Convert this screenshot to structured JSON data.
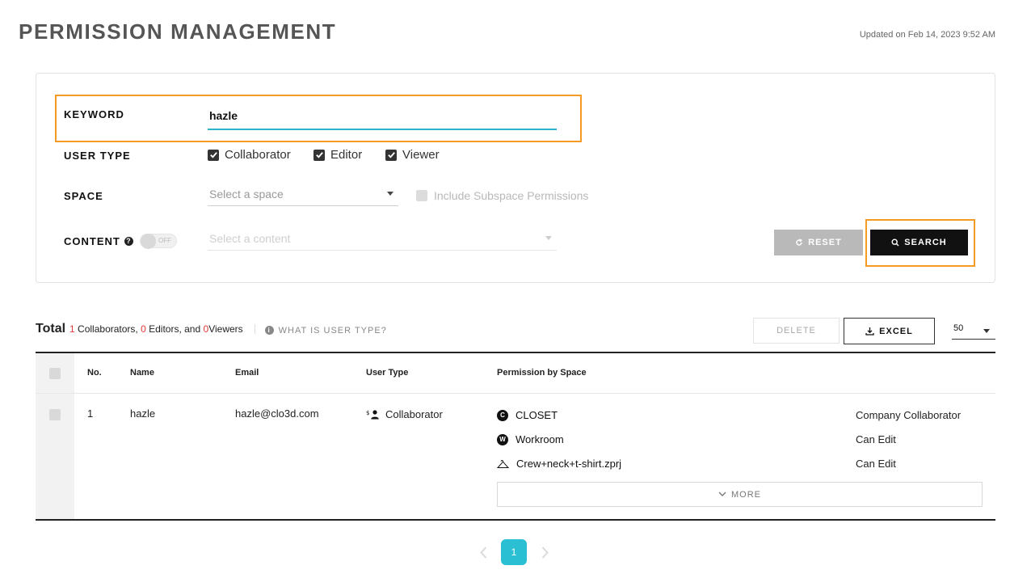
{
  "header": {
    "title": "PERMISSION MANAGEMENT",
    "updated": "Updated on Feb 14, 2023 9:52 AM"
  },
  "filters": {
    "keyword_label": "KEYWORD",
    "keyword_value": "hazle",
    "user_type_label": "USER TYPE",
    "user_types": [
      {
        "label": "Collaborator",
        "checked": true
      },
      {
        "label": "Editor",
        "checked": true
      },
      {
        "label": "Viewer",
        "checked": true
      }
    ],
    "space_label": "SPACE",
    "space_placeholder": "Select a space",
    "subspace_label": "Include Subspace Permissions",
    "content_label": "CONTENT",
    "content_toggle": "OFF",
    "content_placeholder": "Select a content",
    "reset_label": "RESET",
    "search_label": "SEARCH"
  },
  "summary": {
    "total_label": "Total",
    "collaborators_count": "1",
    "collaborators_text": " Collaborators, ",
    "editors_count": "0",
    "editors_text": " Editors, and ",
    "viewers_count": "0",
    "viewers_text": " Viewers",
    "what_is_label": "WHAT IS USER TYPE?"
  },
  "toolbar": {
    "delete_label": "DELETE",
    "excel_label": "EXCEL",
    "page_size": "50"
  },
  "table": {
    "headers": [
      "No.",
      "Name",
      "Email",
      "User Type",
      "Permission by Space"
    ],
    "rows": [
      {
        "no": "1",
        "name": "hazle",
        "email": "hazle@clo3d.com",
        "user_type": "Collaborator",
        "spaces": [
          {
            "name": "CLOSET",
            "icon": "closet-logo-icon",
            "permission": "Company Collaborator"
          },
          {
            "name": "Workroom",
            "icon": "workroom-logo-icon",
            "permission": "Can Edit"
          },
          {
            "name": "Crew+neck+t-shirt.zprj",
            "icon": "hanger-icon",
            "permission": "Can Edit"
          }
        ],
        "more_label": "MORE"
      }
    ]
  },
  "pagination": {
    "current_page": "1"
  },
  "colors": {
    "accent": "#29b6c8",
    "highlight": "#f59a23",
    "count_red": "#e53935"
  }
}
